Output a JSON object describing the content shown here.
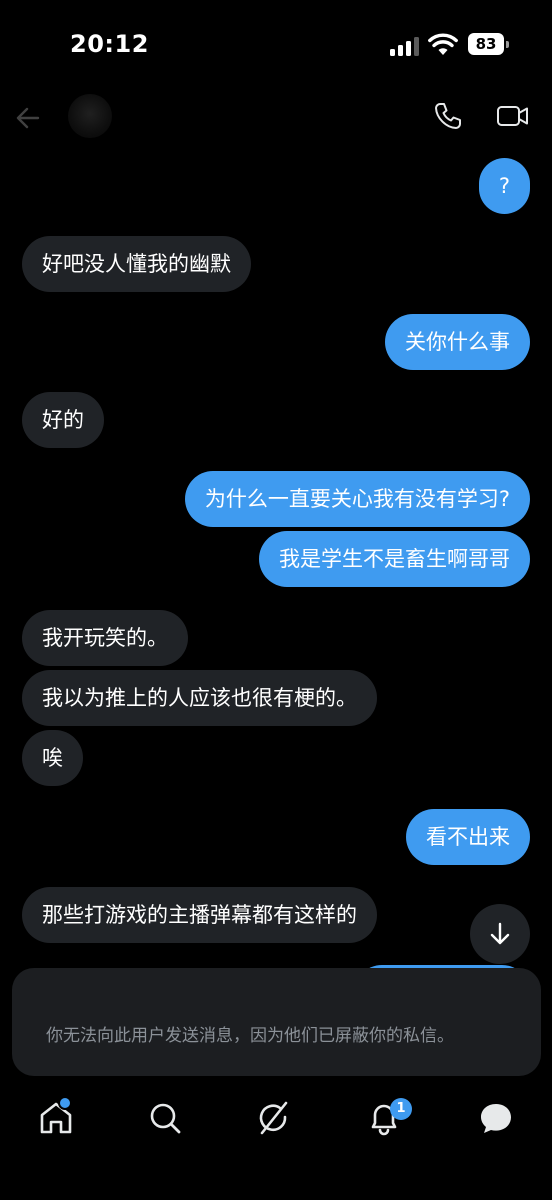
{
  "status_bar": {
    "time": "20:12",
    "battery": "83"
  },
  "header": {},
  "messages": [
    {
      "side": "out",
      "text": "?"
    },
    {
      "side": "in",
      "text": "好吧没人懂我的幽默"
    },
    {
      "side": "out",
      "text": "关你什么事"
    },
    {
      "side": "in",
      "text": "好的"
    },
    {
      "side": "out",
      "text": "为什么一直要关心我有没有学习?"
    },
    {
      "side": "out",
      "text": "我是学生不是畜生啊哥哥"
    },
    {
      "side": "in",
      "text": "我开玩笑的。"
    },
    {
      "side": "in",
      "text": "我以为推上的人应该也很有梗的。"
    },
    {
      "side": "in",
      "text": "唉"
    },
    {
      "side": "out",
      "text": "看不出来"
    },
    {
      "side": "in",
      "text": "那些打游戏的主播弹幕都有这样的"
    }
  ],
  "blocked_notice": "你无法向此用户发送消息，因为他们已屏蔽你的私信。",
  "nav": {
    "items": [
      "home-icon",
      "search-icon",
      "grok-icon",
      "bell-icon",
      "messages-icon"
    ],
    "notifications_badge": "1"
  },
  "colors": {
    "accent": "#3f9bf0",
    "incoming_bubble": "#202327",
    "background": "#000000"
  }
}
